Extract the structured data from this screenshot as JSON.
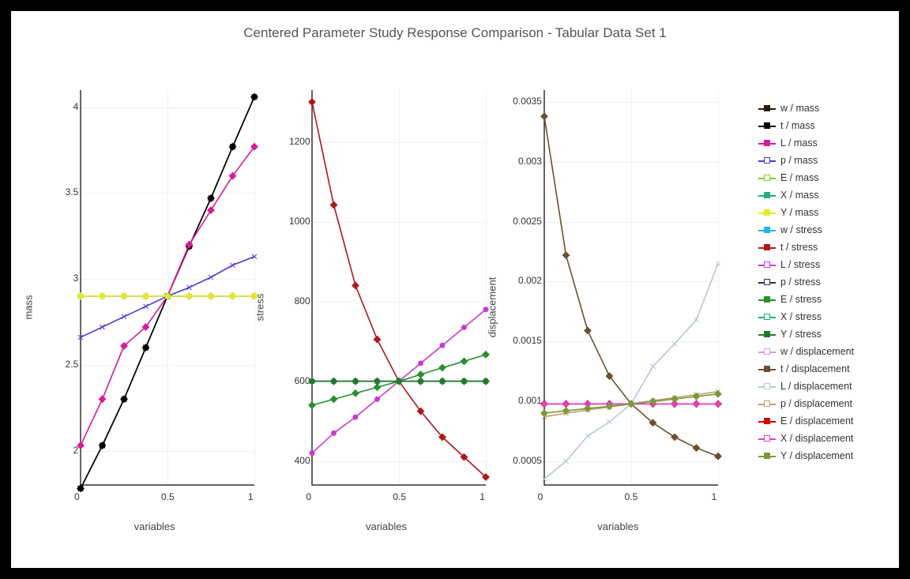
{
  "title": "Centered Parameter Study Response Comparison - Tabular Data Set 1",
  "xlabel": "variables",
  "chart_data": [
    {
      "type": "line",
      "ylabel": "mass",
      "xlim": [
        0,
        1
      ],
      "ylim": [
        1.8,
        4.1
      ],
      "xticks": [
        0,
        0.5,
        1
      ],
      "yticks": [
        2,
        2.5,
        3,
        3.5,
        4
      ],
      "x": [
        0,
        0.125,
        0.25,
        0.375,
        0.5,
        0.625,
        0.75,
        0.875,
        1
      ],
      "series": [
        {
          "name": "w / mass",
          "color": "#2a1a0a",
          "marker": "square",
          "values": [
            1.78,
            2.03,
            2.3,
            2.6,
            2.9,
            3.19,
            3.47,
            3.77,
            4.06
          ]
        },
        {
          "name": "t / mass",
          "color": "#000000",
          "marker": "diamond",
          "values": [
            1.78,
            2.03,
            2.3,
            2.6,
            2.9,
            3.19,
            3.47,
            3.77,
            4.06
          ]
        },
        {
          "name": "L / mass",
          "color": "#d81b99",
          "marker": "diamond",
          "values": [
            2.03,
            2.3,
            2.61,
            2.72,
            2.9,
            3.2,
            3.4,
            3.6,
            3.77
          ]
        },
        {
          "name": "p / mass",
          "color": "#4a3bd1",
          "marker": "x",
          "values": [
            2.66,
            2.72,
            2.78,
            2.84,
            2.9,
            2.95,
            3.01,
            3.08,
            3.13
          ]
        },
        {
          "name": "E / mass",
          "color": "#7dcf2b",
          "marker": "x",
          "values": [
            2.9,
            2.9,
            2.9,
            2.9,
            2.9,
            2.9,
            2.9,
            2.9,
            2.9
          ]
        },
        {
          "name": "X / mass",
          "color": "#1fb07a",
          "marker": "diamond",
          "values": [
            2.9,
            2.9,
            2.9,
            2.9,
            2.9,
            2.9,
            2.9,
            2.9,
            2.9
          ]
        },
        {
          "name": "Y / mass",
          "color": "#e8e82a",
          "marker": "diamond",
          "values": [
            2.9,
            2.9,
            2.9,
            2.9,
            2.9,
            2.9,
            2.9,
            2.9,
            2.9
          ]
        }
      ]
    },
    {
      "type": "line",
      "ylabel": "stress",
      "xlim": [
        0,
        1
      ],
      "ylim": [
        340,
        1330
      ],
      "xticks": [
        0,
        0.5,
        1
      ],
      "yticks": [
        400,
        600,
        800,
        1000,
        1200
      ],
      "x": [
        0,
        0.125,
        0.25,
        0.375,
        0.5,
        0.625,
        0.75,
        0.875,
        1
      ],
      "series": [
        {
          "name": "w / stress",
          "color": "#28b4e0",
          "marker": "diamond",
          "values": [
            600,
            600,
            600,
            600,
            600,
            600,
            600,
            600,
            600
          ]
        },
        {
          "name": "t / stress",
          "color": "#b01818",
          "marker": "diamond",
          "values": [
            1300,
            1042,
            840,
            705,
            600,
            525,
            460,
            410,
            360
          ]
        },
        {
          "name": "L / stress",
          "color": "#c83bd1",
          "marker": "circle",
          "values": [
            420,
            470,
            510,
            555,
            600,
            645,
            690,
            735,
            780
          ]
        },
        {
          "name": "p / stress",
          "color": "#3a2a60",
          "marker": "x",
          "values": [
            600,
            600,
            600,
            600,
            600,
            600,
            600,
            600,
            600
          ]
        },
        {
          "name": "E / stress",
          "color": "#2a8f2e",
          "marker": "diamond",
          "values": [
            540,
            555,
            570,
            585,
            600,
            617,
            634,
            650,
            667
          ]
        },
        {
          "name": "X / stress",
          "color": "#1fb07a",
          "marker": "circle",
          "values": [
            600,
            600,
            600,
            600,
            600,
            600,
            600,
            600,
            600
          ]
        },
        {
          "name": "Y / stress",
          "color": "#1f7a2a",
          "marker": "diamond",
          "values": [
            600,
            600,
            600,
            600,
            600,
            600,
            600,
            600,
            600
          ]
        }
      ]
    },
    {
      "type": "line",
      "ylabel": "displacement",
      "xlim": [
        0,
        1
      ],
      "ylim": [
        0.0003,
        0.0036
      ],
      "xticks": [
        0,
        0.5,
        1
      ],
      "yticks": [
        0.0005,
        0.001,
        0.0015,
        0.002,
        0.0025,
        0.003,
        0.0035
      ],
      "x": [
        0,
        0.125,
        0.25,
        0.375,
        0.5,
        0.625,
        0.75,
        0.875,
        1
      ],
      "series": [
        {
          "name": "w / displacement",
          "color": "#c9a0dc",
          "marker": "diamond",
          "values": [
            0.000978,
            0.000978,
            0.000978,
            0.000978,
            0.000978,
            0.000978,
            0.000978,
            0.000978,
            0.000978
          ]
        },
        {
          "name": "t / displacement",
          "color": "#6b5030",
          "marker": "diamond",
          "values": [
            0.00338,
            0.00222,
            0.00159,
            0.00121,
            0.000978,
            0.00082,
            0.0007,
            0.00061,
            0.00054
          ]
        },
        {
          "name": "L / displacement",
          "color": "#b8c7d6",
          "marker": "x",
          "values": [
            0.00035,
            0.000498,
            0.00071,
            0.000828,
            0.000978,
            0.00129,
            0.00148,
            0.00168,
            0.00215
          ]
        },
        {
          "name": "p / displacement",
          "color": "#c49a6c",
          "marker": "x",
          "values": [
            0.00087,
            0.0009,
            0.000927,
            0.000952,
            0.000978,
            0.001005,
            0.00103,
            0.001055,
            0.00108
          ]
        },
        {
          "name": "E / displacement",
          "color": "#d30808",
          "marker": "diamond",
          "values": [
            0.000978,
            0.000978,
            0.000978,
            0.000978,
            0.000978,
            0.000978,
            0.000978,
            0.000978,
            0.000978
          ]
        },
        {
          "name": "X / displacement",
          "color": "#e040c0",
          "marker": "circle",
          "values": [
            0.000978,
            0.000978,
            0.000978,
            0.000978,
            0.000978,
            0.000978,
            0.000978,
            0.000978,
            0.000978
          ]
        },
        {
          "name": "Y / displacement",
          "color": "#7a9a3a",
          "marker": "diamond",
          "values": [
            0.0009,
            0.00092,
            0.00094,
            0.000958,
            0.000978,
            0.000998,
            0.001018,
            0.00104,
            0.00106
          ]
        }
      ]
    }
  ],
  "legend": [
    {
      "label": "w / mass",
      "color": "#2a1a0a",
      "fill": "#2a1a0a"
    },
    {
      "label": "t / mass",
      "color": "#000000",
      "fill": "#000000"
    },
    {
      "label": "L / mass",
      "color": "#d81b99",
      "fill": "#d81b99"
    },
    {
      "label": "p / mass",
      "color": "#4a3bd1",
      "fill": "#ffffff"
    },
    {
      "label": "E / mass",
      "color": "#7dcf2b",
      "fill": "#ffffff"
    },
    {
      "label": "X / mass",
      "color": "#1fb07a",
      "fill": "#1fb07a"
    },
    {
      "label": "Y / mass",
      "color": "#e8e82a",
      "fill": "#e8e82a"
    },
    {
      "label": "w / stress",
      "color": "#28b4e0",
      "fill": "#28b4e0"
    },
    {
      "label": "t / stress",
      "color": "#b01818",
      "fill": "#b01818"
    },
    {
      "label": "L / stress",
      "color": "#c83bd1",
      "fill": "#ffffff"
    },
    {
      "label": "p / stress",
      "color": "#3a2a60",
      "fill": "#ffffff"
    },
    {
      "label": "E / stress",
      "color": "#2a8f2e",
      "fill": "#2a8f2e"
    },
    {
      "label": "X / stress",
      "color": "#1fb07a",
      "fill": "#ffffff"
    },
    {
      "label": "Y / stress",
      "color": "#1f7a2a",
      "fill": "#1f7a2a"
    },
    {
      "label": "w / displacement",
      "color": "#c9a0dc",
      "fill": "#ffffff"
    },
    {
      "label": "t / displacement",
      "color": "#6b5030",
      "fill": "#6b5030"
    },
    {
      "label": "L / displacement",
      "color": "#b8c7d6",
      "fill": "#ffffff"
    },
    {
      "label": "p / displacement",
      "color": "#c49a6c",
      "fill": "#ffffff"
    },
    {
      "label": "E / displacement",
      "color": "#d30808",
      "fill": "#d30808"
    },
    {
      "label": "X / displacement",
      "color": "#e040c0",
      "fill": "#ffffff"
    },
    {
      "label": "Y / displacement",
      "color": "#7a9a3a",
      "fill": "#7a9a3a"
    }
  ]
}
